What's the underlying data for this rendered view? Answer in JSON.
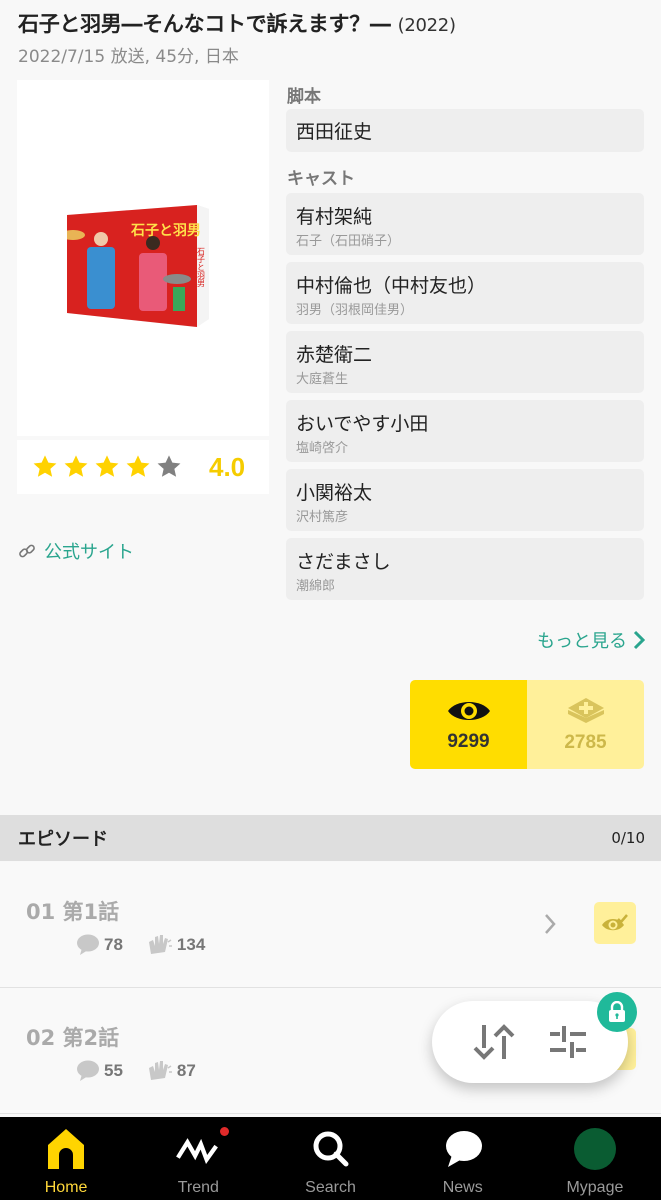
{
  "title": {
    "main": "石子と羽男―そんなコトで訴えます？―",
    "year": "(2022)",
    "subtitle": "2022/7/15 放送, 45分, 日本"
  },
  "rating": {
    "value": "4.0",
    "stars_filled": 4,
    "stars_total": 5
  },
  "official_site": {
    "label": "公式サイト",
    "icon": "link-icon"
  },
  "writer": {
    "label": "脚本",
    "name": "西田征史"
  },
  "cast": {
    "label": "キャスト",
    "items": [
      {
        "name": "有村架純",
        "role": "石子（石田硝子）"
      },
      {
        "name": "中村倫也（中村友也）",
        "role": "羽男（羽根岡佳男）"
      },
      {
        "name": "赤楚衛二",
        "role": "大庭蒼生"
      },
      {
        "name": "おいでやす小田",
        "role": "塩崎啓介"
      },
      {
        "name": "小関裕太",
        "role": "沢村篤彦"
      },
      {
        "name": "さだまさし",
        "role": "潮綿郎"
      }
    ],
    "more_label": "もっと見る"
  },
  "actions": {
    "watched": {
      "icon": "eye-icon",
      "count": "9299"
    },
    "wish": {
      "icon": "stack-plus-icon",
      "count": "2785"
    }
  },
  "colors": {
    "accent_yellow": "#ffdd00",
    "light_yellow": "#fff09a",
    "teal": "#2aa58e",
    "lock_green": "#20b99a"
  },
  "episodes": {
    "label": "エピソード",
    "progress": "0/10",
    "items": [
      {
        "title": "01 第1話",
        "comments": "78",
        "claps": "134"
      },
      {
        "title": "02 第2話",
        "comments": "55",
        "claps": "87"
      }
    ]
  },
  "tabbar": {
    "items": [
      {
        "label": "Home",
        "icon": "home-icon",
        "active": true
      },
      {
        "label": "Trend",
        "icon": "trend-icon",
        "badge": true
      },
      {
        "label": "Search",
        "icon": "search-icon"
      },
      {
        "label": "News",
        "icon": "speech-bubble-icon"
      },
      {
        "label": "Mypage",
        "icon": "avatar-icon"
      }
    ]
  }
}
